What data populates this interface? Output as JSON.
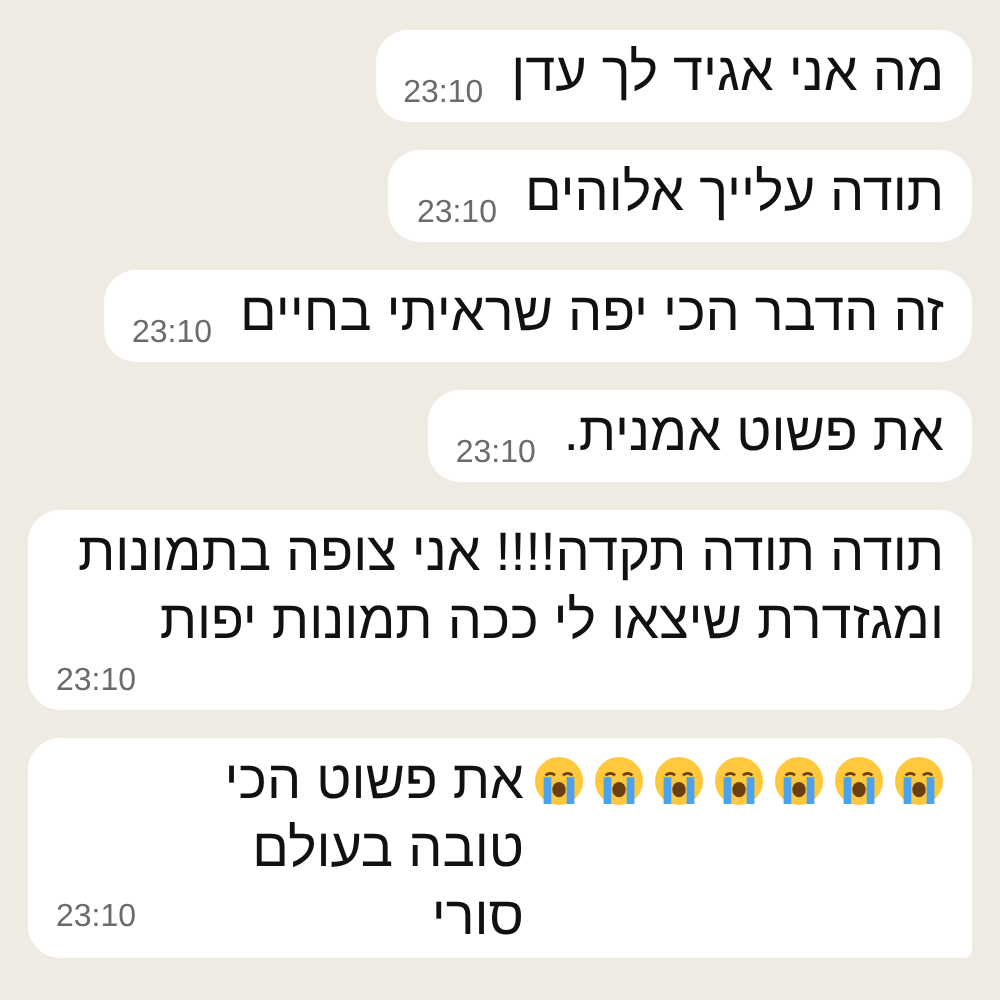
{
  "messages": [
    {
      "text": "מה אני אגיד לך עדן",
      "time": "23:10"
    },
    {
      "text": "תודה עלייך אלוהים",
      "time": "23:10"
    },
    {
      "text": "זה הדבר הכי יפה שראיתי בחיים",
      "time": "23:10"
    },
    {
      "text": "את פשוט אמנית.",
      "time": "23:10"
    },
    {
      "text": "תודה תודה תקדה!!!! אני צופה בתמונות ומגזדרת שיצאו לי ככה תמונות יפות",
      "time": "23:10",
      "time_on_own_line": true
    },
    {
      "icons": [
        {
          "kind": "crying"
        },
        {
          "kind": "crying"
        },
        {
          "kind": "crying"
        },
        {
          "kind": "crying"
        },
        {
          "kind": "crying"
        },
        {
          "kind": "crying"
        },
        {
          "kind": "crying"
        }
      ],
      "text": "את פשוט הכי טובה בעולם סורי",
      "time": "23:10",
      "tail": true
    }
  ]
}
